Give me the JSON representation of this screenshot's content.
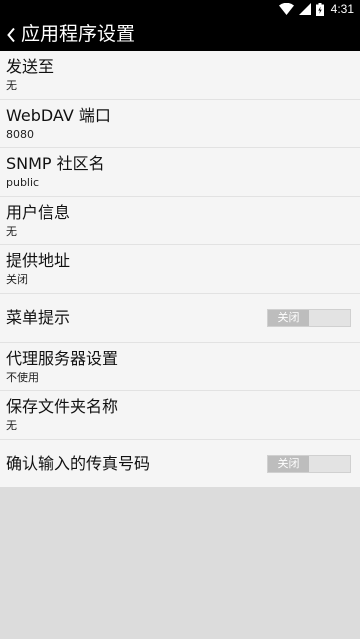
{
  "status_bar": {
    "time": "4:31",
    "icons": [
      "wifi-icon",
      "signal-icon",
      "battery-icon"
    ]
  },
  "header": {
    "title": "应用程序设置",
    "back_icon": "chevron-left-icon"
  },
  "settings": [
    {
      "title": "发送至",
      "value": "无"
    },
    {
      "title": "WebDAV 端口",
      "value": "8080"
    },
    {
      "title": "SNMP 社区名",
      "value": "public"
    },
    {
      "title": "用户信息",
      "value": "无"
    },
    {
      "title": "提供地址",
      "value": "关闭"
    },
    {
      "title": "菜单提示",
      "toggle_label": "关闭"
    },
    {
      "title": "代理服务器设置",
      "value": "不使用"
    },
    {
      "title": "保存文件夹名称",
      "value": "无"
    },
    {
      "title": "确认输入的传真号码",
      "toggle_label": "关闭"
    }
  ],
  "colors": {
    "bar_background": "#000000",
    "list_background": "#f5f5f5",
    "page_background": "#dcdcdc",
    "toggle_off": "#bdbdbd"
  }
}
